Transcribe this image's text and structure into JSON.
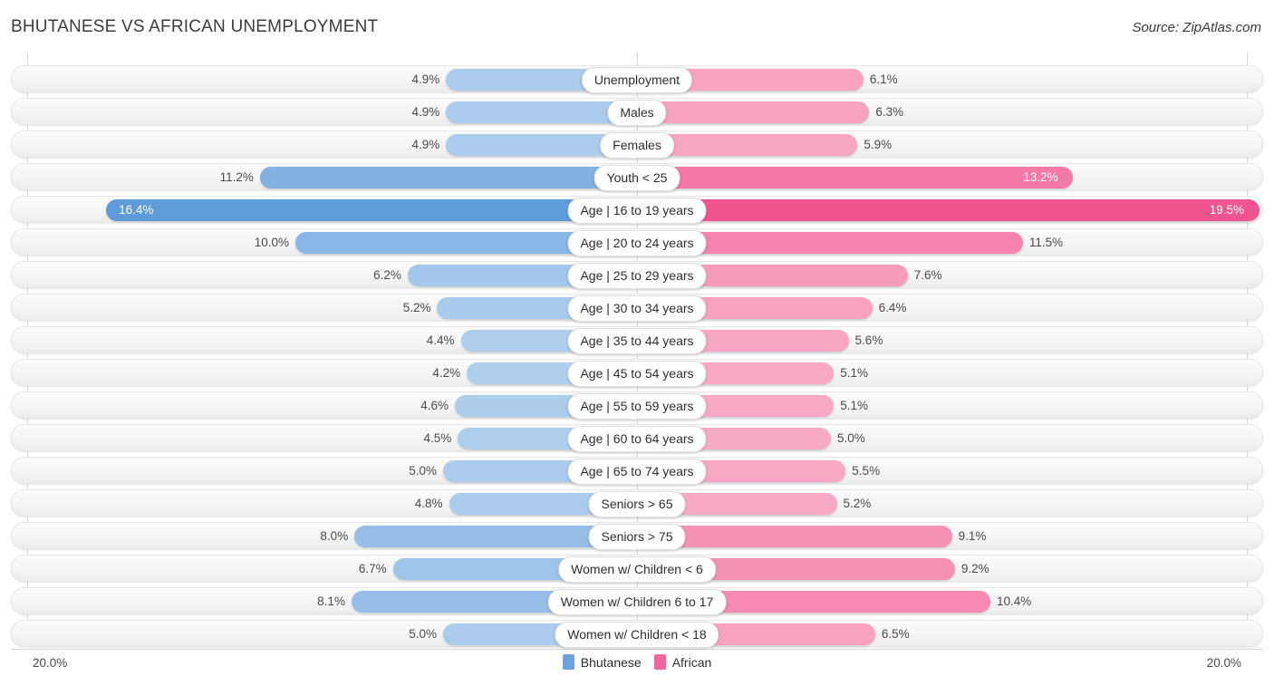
{
  "title": "BHUTANESE VS AFRICAN UNEMPLOYMENT",
  "source": "Source: ZipAtlas.com",
  "axis": {
    "left": "20.0%",
    "right": "20.0%"
  },
  "legend": [
    {
      "label": "Bhutanese",
      "color": "#6aa3e0"
    },
    {
      "label": "African",
      "color": "#f2689c"
    }
  ],
  "chart_data": {
    "type": "bar",
    "orientation": "horizontal-diverging",
    "title": "BHUTANESE VS AFRICAN UNEMPLOYMENT",
    "xlabel": "",
    "ylabel": "",
    "xlim": [
      20.0,
      20.0
    ],
    "grid": true,
    "legend_position": "bottom-center",
    "categories": [
      "Unemployment",
      "Males",
      "Females",
      "Youth < 25",
      "Age | 16 to 19 years",
      "Age | 20 to 24 years",
      "Age | 25 to 29 years",
      "Age | 30 to 34 years",
      "Age | 35 to 44 years",
      "Age | 45 to 54 years",
      "Age | 55 to 59 years",
      "Age | 60 to 64 years",
      "Age | 65 to 74 years",
      "Seniors > 65",
      "Seniors > 75",
      "Women w/ Children < 6",
      "Women w/ Children 6 to 17",
      "Women w/ Children < 18"
    ],
    "series": [
      {
        "name": "Bhutanese",
        "values": [
          4.9,
          4.9,
          4.9,
          11.2,
          16.4,
          10.0,
          6.2,
          5.2,
          4.4,
          4.2,
          4.6,
          4.5,
          5.0,
          4.8,
          8.0,
          6.7,
          8.1,
          5.0
        ],
        "labels": [
          "4.9%",
          "4.9%",
          "4.9%",
          "11.2%",
          "16.4%",
          "10.0%",
          "6.2%",
          "5.2%",
          "4.4%",
          "4.2%",
          "4.6%",
          "4.5%",
          "5.0%",
          "4.8%",
          "8.0%",
          "6.7%",
          "8.1%",
          "5.0%"
        ]
      },
      {
        "name": "African",
        "values": [
          6.1,
          6.3,
          5.9,
          13.2,
          19.5,
          11.5,
          7.6,
          6.4,
          5.6,
          5.1,
          5.1,
          5.0,
          5.5,
          5.2,
          9.1,
          9.2,
          10.4,
          6.5
        ],
        "labels": [
          "6.1%",
          "6.3%",
          "5.9%",
          "13.2%",
          "19.5%",
          "11.5%",
          "7.6%",
          "6.4%",
          "5.6%",
          "5.1%",
          "5.1%",
          "5.0%",
          "5.5%",
          "5.2%",
          "9.1%",
          "9.2%",
          "10.4%",
          "6.5%"
        ]
      }
    ]
  }
}
